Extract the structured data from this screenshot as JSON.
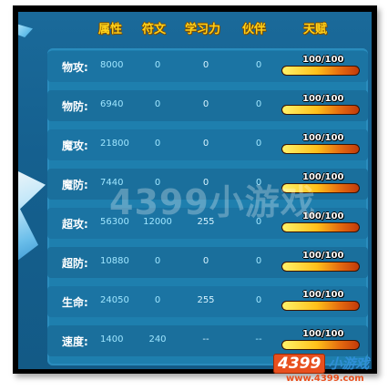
{
  "header": {
    "columns": [
      "属性",
      "符文",
      "学习力",
      "伙伴",
      "天赋"
    ]
  },
  "rows": [
    {
      "label": "物攻:",
      "base": "8000",
      "rune": "0",
      "learning": "0",
      "partner": "0",
      "talent": "100/100",
      "talent_fraction": 1.0
    },
    {
      "label": "物防:",
      "base": "6940",
      "rune": "0",
      "learning": "0",
      "partner": "0",
      "talent": "100/100",
      "talent_fraction": 1.0
    },
    {
      "label": "魔攻:",
      "base": "21800",
      "rune": "0",
      "learning": "0",
      "partner": "0",
      "talent": "100/100",
      "talent_fraction": 1.0
    },
    {
      "label": "魔防:",
      "base": "7440",
      "rune": "0",
      "learning": "0",
      "partner": "0",
      "talent": "100/100",
      "talent_fraction": 1.0
    },
    {
      "label": "超攻:",
      "base": "56300",
      "rune": "12000",
      "learning": "255",
      "partner": "0",
      "talent": "100/100",
      "talent_fraction": 1.0
    },
    {
      "label": "超防:",
      "base": "10880",
      "rune": "0",
      "learning": "0",
      "partner": "0",
      "talent": "100/100",
      "talent_fraction": 1.0
    },
    {
      "label": "生命:",
      "base": "24050",
      "rune": "0",
      "learning": "255",
      "partner": "0",
      "talent": "100/100",
      "talent_fraction": 1.0
    },
    {
      "label": "速度:",
      "base": "1400",
      "rune": "240",
      "learning": "--",
      "partner": "--",
      "talent": "100/100",
      "talent_fraction": 1.0
    }
  ],
  "watermark": "4399小游戏",
  "logo": {
    "number": "4399",
    "text": "小游戏",
    "url": "www.4399.com"
  },
  "colors": {
    "header_text": "#ffd21a",
    "value_text": "#9fe6ff",
    "label_text": "#ffffff",
    "bar_gold": "#ffc01a",
    "bar_red": "#c23a0a",
    "panel_blue": "#1e7fae",
    "logo_orange": "#e8501e"
  }
}
